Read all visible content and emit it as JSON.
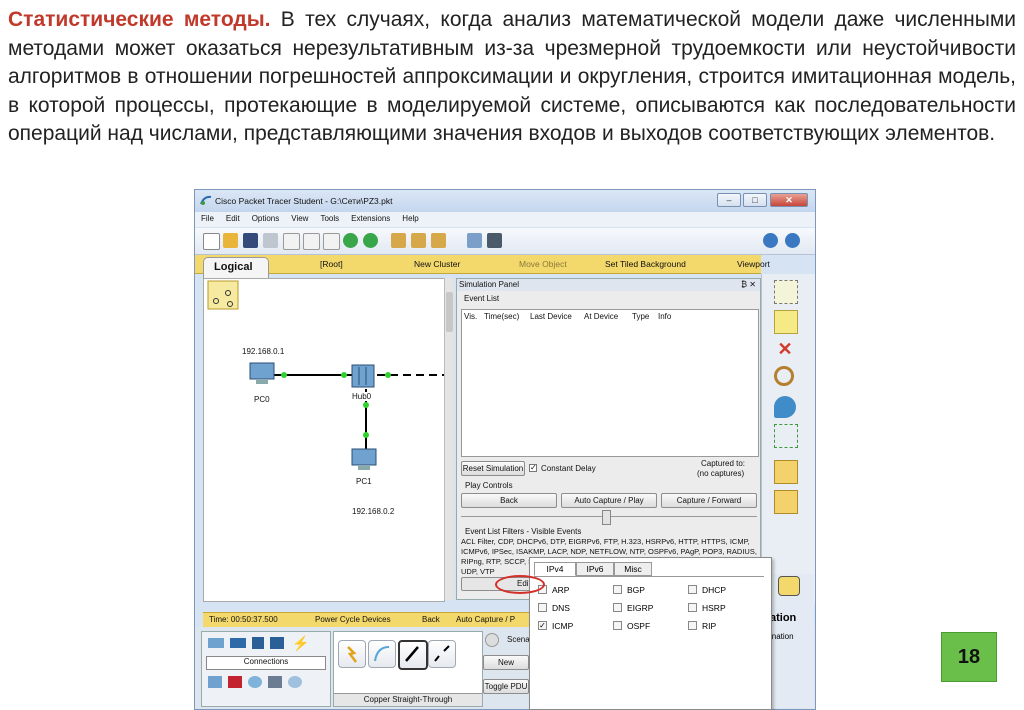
{
  "slide": {
    "lead": "Статистические методы.",
    "text": " В тех случаях, когда анализ математической модели даже численными методами может оказаться нерезультативным из-за чрезмерной трудоемкости или неустойчивости алгоритмов в отношении погрешностей аппроксимации и округления, строится имитационная модель, в которой процессы, протекающие в моделируемой системе, описываются как последовательности операций над числами, представляющими значения входов и выходов соответствующих элементов.",
    "page_number": "18"
  },
  "window": {
    "title": "Cisco Packet Tracer Student - G:\\Сети\\PZ3.pkt",
    "controls": {
      "minimize": "–",
      "maximize": "□",
      "close": "✕"
    },
    "menu": [
      "File",
      "Edit",
      "Options",
      "View",
      "Tools",
      "Extensions",
      "Help"
    ],
    "workspace_bar": {
      "logical": "Logical",
      "root": "[Root]",
      "new_cluster": "New Cluster",
      "move_object": "Move Object",
      "set_tiled_background": "Set Tiled Background",
      "viewport": "Viewport"
    },
    "network": {
      "ip_top": "192.168.0.1",
      "ip_bottom": "192.168.0.2",
      "pc0": "PC0",
      "hub": "Hub0",
      "pc1": "PC1"
    },
    "simulation": {
      "panel_title": "Simulation Panel",
      "panel_controls": "₿ ✕",
      "event_list": "Event List",
      "columns": [
        "Vis.",
        "Time(sec)",
        "Last Device",
        "At Device",
        "Type",
        "Info"
      ],
      "reset_simulation": "Reset Simulation",
      "constant_delay": "Constant Delay",
      "captured_to": "Captured to:",
      "no_captures": "(no captures)",
      "play_controls": "Play Controls",
      "back": "Back",
      "auto_capture_play": "Auto Capture / Play",
      "capture_forward": "Capture / Forward",
      "filters_title": "Event List Filters - Visible Events",
      "filters_text": "ACL Filter, CDP, DHCPv6, DTP, EIGRPv6, FTP, H.323, HSRPv6, HTTP, HTTPS, ICMP, ICMPv6, IPSec, ISAKMP, LACP, NDP, NETFLOW, NTP, OSPFv6, PAgP, POP3, RADIUS, RIPng, RTP, SCCP, SMTP, SNMP, SSH, STP, SYSLOG, TACACS, TCP, TFTP, Telnet, UDP, VTP",
      "edit_filters": "Edit F"
    },
    "status_bar": {
      "time": "Time: 00:50:37.500",
      "power_cycle": "Power Cycle Devices",
      "back": "Back",
      "auto_capture": "Auto Capture / P"
    },
    "bottom": {
      "connections_label": "Connections",
      "cable_label": "Copper Straight-Through",
      "scenario": "Scena",
      "new_button": "New",
      "toggle_pdu": "Toggle PDU",
      "simulation_label": "ation",
      "destination_label": "ination"
    },
    "filter_popup": {
      "tabs": [
        "IPv4",
        "IPv6",
        "Misc"
      ],
      "rows": [
        [
          "ARP",
          "BGP",
          "DHCP"
        ],
        [
          "DNS",
          "EIGRP",
          "HSRP"
        ],
        [
          "ICMP",
          "OSPF",
          "RIP"
        ]
      ],
      "checked": [
        "ICMP"
      ]
    },
    "colors": {
      "workspace_bar": "#f3d86c",
      "lead_text": "#c0392b",
      "page_badge": "#6abf4b",
      "highlight_circle": "#d4302a"
    }
  }
}
